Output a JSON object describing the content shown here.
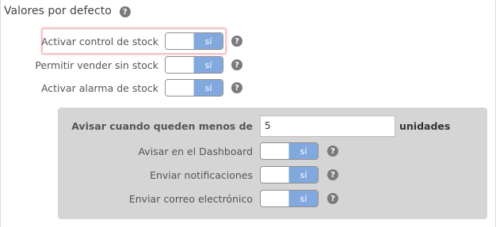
{
  "section": {
    "title": "Valores por defecto",
    "help_glyph": "?"
  },
  "rows": [
    {
      "label": "Activar control de stock",
      "toggle": "sí",
      "help": "?"
    },
    {
      "label": "Permitir vender sin stock",
      "toggle": "sí",
      "help": "?"
    },
    {
      "label": "Activar alarma de stock",
      "toggle": "sí",
      "help": "?"
    }
  ],
  "alarm": {
    "threshold_label": "Avisar cuando queden menos de",
    "threshold_value": "5",
    "unit": "unidades",
    "options": [
      {
        "label": "Avisar en el Dashboard",
        "toggle": "sí",
        "help": "?"
      },
      {
        "label": "Enviar notificaciones",
        "toggle": "sí",
        "help": "?"
      },
      {
        "label": "Enviar correo electrónico",
        "toggle": "sí",
        "help": "?"
      }
    ]
  },
  "colors": {
    "toggle_on": "#82a9de",
    "panel_bg": "#d5d5d5",
    "highlight": "#f2c3c6"
  },
  "icons": {
    "help": "question-circle-icon"
  }
}
